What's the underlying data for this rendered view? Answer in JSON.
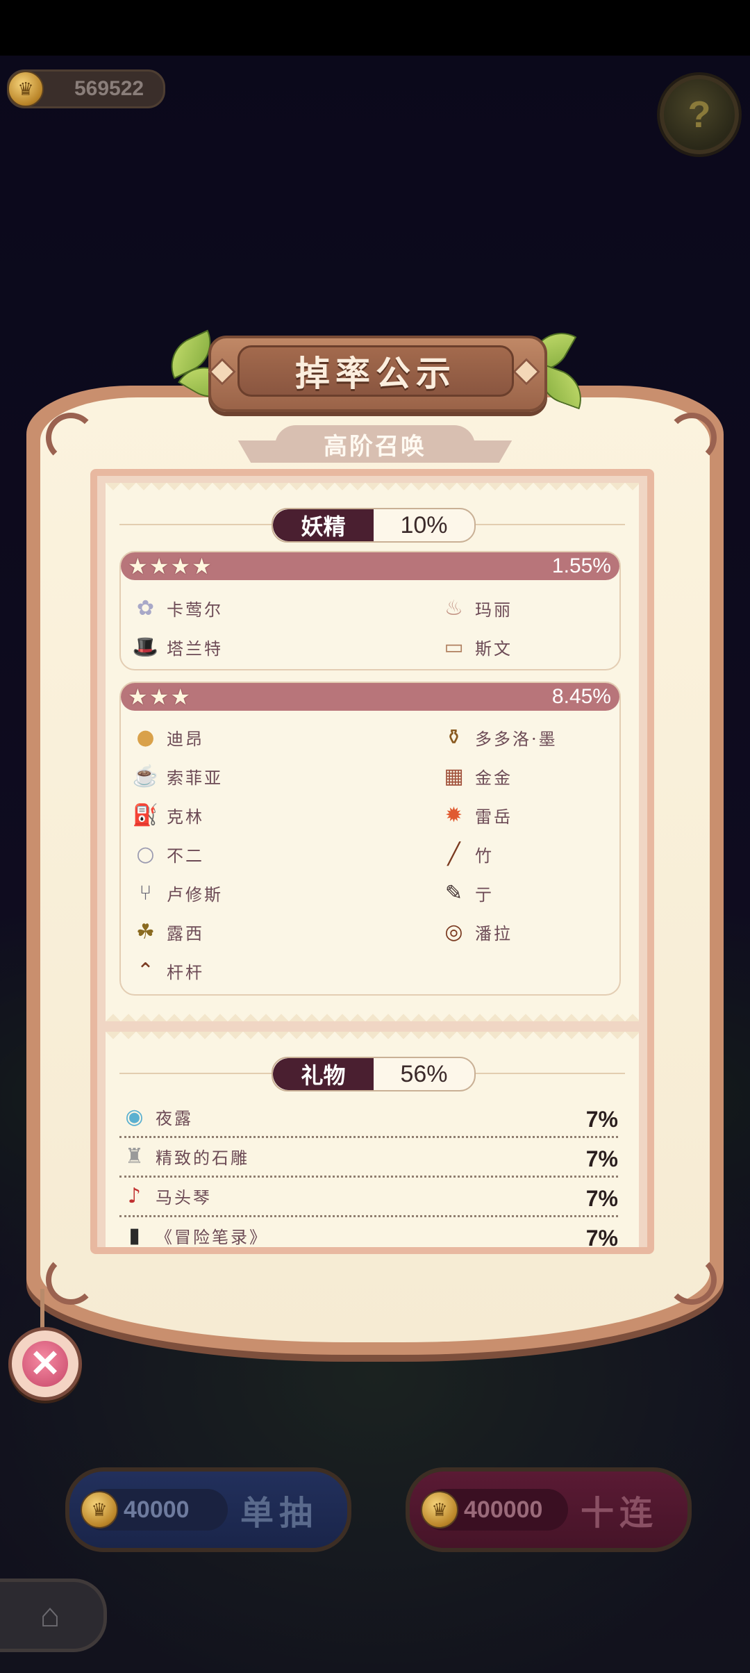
{
  "hud": {
    "coins": "569522",
    "coin_icon": "coin-icon",
    "help_icon": "?"
  },
  "modal": {
    "title": "掉率公示",
    "subtitle": "高阶召唤",
    "fairy_section": {
      "label": "妖精",
      "rate": "10%",
      "tiers": [
        {
          "stars": "★★★★",
          "rate": "1.55%",
          "items": [
            {
              "name": "卡莺尔",
              "icon": "✿"
            },
            {
              "name": "玛丽",
              "icon": "♨"
            },
            {
              "name": "塔兰特",
              "icon": "🎩"
            },
            {
              "name": "斯文",
              "icon": "▭"
            }
          ]
        },
        {
          "stars": "★★★",
          "rate": "8.45%",
          "items": [
            {
              "name": "迪昂",
              "icon": "●"
            },
            {
              "name": "多多洛·墨",
              "icon": "⚱"
            },
            {
              "name": "索菲亚",
              "icon": "☕"
            },
            {
              "name": "金金",
              "icon": "▦"
            },
            {
              "name": "克林",
              "icon": "⛽"
            },
            {
              "name": "雷岳",
              "icon": "✹"
            },
            {
              "name": "不二",
              "icon": "○"
            },
            {
              "name": "竹",
              "icon": "╱"
            },
            {
              "name": "卢修斯",
              "icon": "⑂"
            },
            {
              "name": "亍",
              "icon": "✎"
            },
            {
              "name": "露西",
              "icon": "☘"
            },
            {
              "name": "潘拉",
              "icon": "◎"
            },
            {
              "name": "杆杆",
              "icon": "⌃"
            }
          ]
        }
      ]
    },
    "gift_section": {
      "label": "礼物",
      "rate": "56%",
      "items": [
        {
          "name": "夜露",
          "icon": "◉",
          "rate": "7%"
        },
        {
          "name": "精致的石雕",
          "icon": "♜",
          "rate": "7%"
        },
        {
          "name": "马头琴",
          "icon": "♪",
          "rate": "7%"
        },
        {
          "name": "《冒险笔录》",
          "icon": "▮",
          "rate": "7%"
        }
      ]
    },
    "close_label": "✕"
  },
  "buttons": {
    "single": {
      "cost": "40000",
      "label": "单抽"
    },
    "ten": {
      "cost": "400000",
      "label": "十连"
    },
    "home_icon": "⌂"
  },
  "colors": {
    "frame": "#c98f6e",
    "parchment": "#fbf3de",
    "tier_header": "#b8757a",
    "pill_dark": "#4a1f30"
  }
}
